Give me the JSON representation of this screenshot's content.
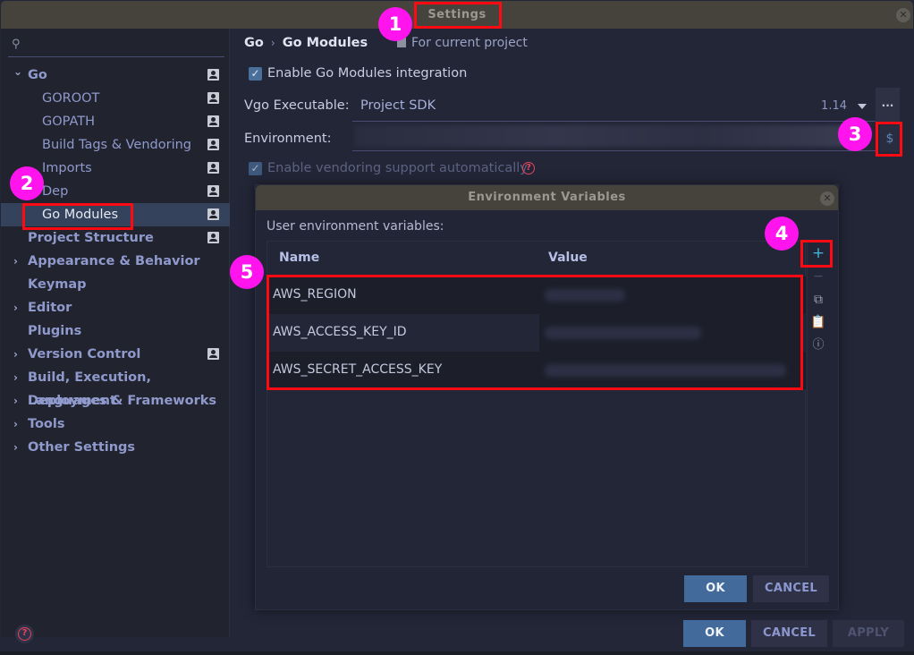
{
  "window": {
    "title": "Settings"
  },
  "sidebar": {
    "search_placeholder": "",
    "items": [
      {
        "label": "Go",
        "expanded": true,
        "bold": true,
        "project_icon": true
      },
      {
        "label": "GOROOT",
        "project_icon": true
      },
      {
        "label": "GOPATH",
        "project_icon": true
      },
      {
        "label": "Build Tags & Vendoring",
        "project_icon": true
      },
      {
        "label": "Imports",
        "project_icon": true
      },
      {
        "label": "Dep",
        "project_icon": true
      },
      {
        "label": "Go Modules",
        "selected": true,
        "project_icon": true
      },
      {
        "label": "Project Structure",
        "bold": true,
        "project_icon": true
      },
      {
        "label": "Appearance & Behavior",
        "bold": true,
        "collapsed": true
      },
      {
        "label": "Keymap",
        "bold": true
      },
      {
        "label": "Editor",
        "bold": true,
        "collapsed": true
      },
      {
        "label": "Plugins",
        "bold": true
      },
      {
        "label": "Version Control",
        "bold": true,
        "collapsed": true,
        "project_icon": true
      },
      {
        "label": "Build, Execution, Deployment",
        "bold": true,
        "collapsed": true
      },
      {
        "label": "Languages & Frameworks",
        "bold": true,
        "collapsed": true
      },
      {
        "label": "Tools",
        "bold": true,
        "collapsed": true
      },
      {
        "label": "Other Settings",
        "bold": true,
        "collapsed": true
      }
    ]
  },
  "main": {
    "breadcrumb": [
      "Go",
      "Go Modules"
    ],
    "breadcrumb_sep": "›",
    "scope": "For current project",
    "enable_modules": {
      "label": "Enable Go Modules integration",
      "checked": true
    },
    "vgo": {
      "label": "Vgo Executable:",
      "value": "Project SDK",
      "version": "1.14",
      "browse_label": "..."
    },
    "environment": {
      "label": "Environment:",
      "value_hidden": true,
      "button_glyph": "$"
    },
    "vendoring": {
      "label": "Enable vendoring support automatically",
      "checked": true,
      "disabled": true
    }
  },
  "env_dialog": {
    "title": "Environment Variables",
    "subtitle": "User environment variables:",
    "columns": [
      "Name",
      "Value"
    ],
    "rows": [
      {
        "name": "AWS_REGION",
        "value": "(blurred)"
      },
      {
        "name": "AWS_ACCESS_KEY_ID",
        "value": "(blurred)"
      },
      {
        "name": "AWS_SECRET_ACCESS_KEY",
        "value": "(blurred)"
      }
    ],
    "tools": {
      "add": "+",
      "remove": "−",
      "copy": "copy",
      "paste": "paste",
      "help": "?"
    },
    "ok_label": "OK",
    "cancel_label": "CANCEL"
  },
  "footer": {
    "ok_label": "OK",
    "cancel_label": "CANCEL",
    "apply_label": "APPLY",
    "help": "?"
  },
  "annotations": {
    "badges": [
      "1",
      "2",
      "3",
      "4",
      "5"
    ],
    "badge_color": "#ff14ee",
    "box_color": "#ff0a12"
  },
  "colors": {
    "accent": "#426a9b",
    "title_bar": "#45433c",
    "background": "#232637",
    "selected": "#34425c"
  }
}
